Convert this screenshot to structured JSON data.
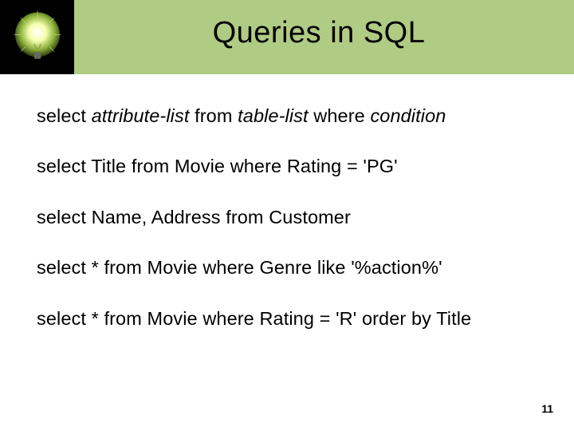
{
  "title": "Queries in SQL",
  "lines": {
    "l1": {
      "a": "select ",
      "b": "attribute-list",
      "c": " from ",
      "d": "table-list",
      "e": " where ",
      "f": "condition"
    },
    "l2": "select Title from Movie where Rating = 'PG'",
    "l3": "select Name, Address from Customer",
    "l4": "select * from Movie where Genre like '%action%'",
    "l5": "select * from Movie where Rating = 'R' order by Title"
  },
  "page_number": "11"
}
